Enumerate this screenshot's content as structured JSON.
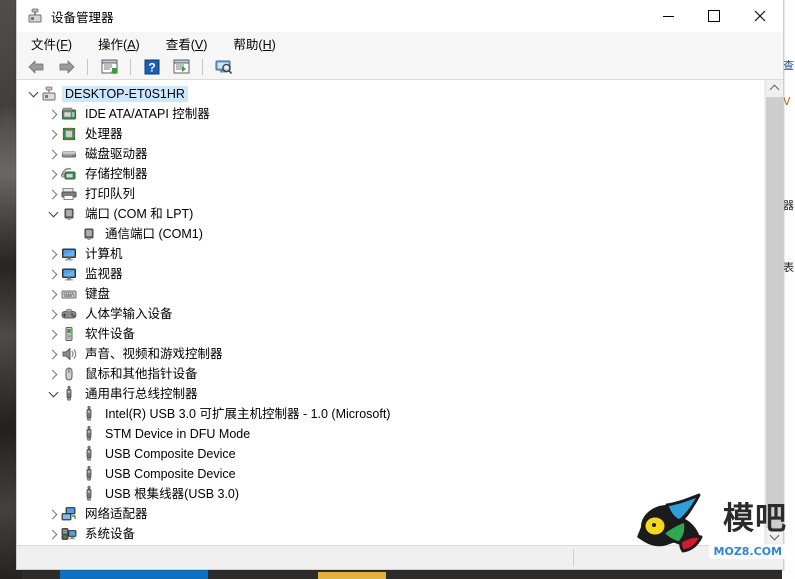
{
  "window": {
    "title": "设备管理器",
    "icon": "device-manager-icon",
    "controls": {
      "minimize": "–",
      "maximize": "□",
      "close": "✕"
    }
  },
  "menubar": {
    "items": [
      {
        "name": "file",
        "text": "文件",
        "accel": "F"
      },
      {
        "name": "action",
        "text": "操作",
        "accel": "A"
      },
      {
        "name": "view",
        "text": "查看",
        "accel": "V"
      },
      {
        "name": "help",
        "text": "帮助",
        "accel": "H"
      }
    ]
  },
  "toolbar": {
    "buttons": [
      {
        "name": "back-button",
        "icon": "back-arrow-icon"
      },
      {
        "name": "forward-button",
        "icon": "forward-arrow-icon"
      },
      {
        "name": "properties-button",
        "icon": "properties-icon"
      },
      {
        "name": "help-button",
        "icon": "help-question-icon"
      },
      {
        "name": "update-driver-button",
        "icon": "update-driver-icon"
      },
      {
        "name": "scan-hardware-button",
        "icon": "scan-hardware-icon"
      }
    ]
  },
  "tree": {
    "nodes": [
      {
        "label": "DESKTOP-ET0S1HR",
        "depth": 0,
        "state": "expanded",
        "icon": "computer-node-icon",
        "selected": true
      },
      {
        "label": "IDE ATA/ATAPI 控制器",
        "depth": 1,
        "state": "collapsed",
        "icon": "ide-controller-icon",
        "selected": false
      },
      {
        "label": "处理器",
        "depth": 1,
        "state": "collapsed",
        "icon": "processor-icon",
        "selected": false
      },
      {
        "label": "磁盘驱动器",
        "depth": 1,
        "state": "collapsed",
        "icon": "disk-drive-icon",
        "selected": false
      },
      {
        "label": "存储控制器",
        "depth": 1,
        "state": "collapsed",
        "icon": "storage-controller-icon",
        "selected": false
      },
      {
        "label": "打印队列",
        "depth": 1,
        "state": "collapsed",
        "icon": "print-queue-icon",
        "selected": false
      },
      {
        "label": "端口 (COM 和 LPT)",
        "depth": 1,
        "state": "expanded",
        "icon": "port-icon",
        "selected": false
      },
      {
        "label": "通信端口 (COM1)",
        "depth": 2,
        "state": "leaf",
        "icon": "port-icon",
        "selected": false
      },
      {
        "label": "计算机",
        "depth": 1,
        "state": "collapsed",
        "icon": "monitor-icon",
        "selected": false
      },
      {
        "label": "监视器",
        "depth": 1,
        "state": "collapsed",
        "icon": "monitor-icon",
        "selected": false
      },
      {
        "label": "键盘",
        "depth": 1,
        "state": "collapsed",
        "icon": "keyboard-icon",
        "selected": false
      },
      {
        "label": "人体学输入设备",
        "depth": 1,
        "state": "collapsed",
        "icon": "hid-gamepad-icon",
        "selected": false
      },
      {
        "label": "软件设备",
        "depth": 1,
        "state": "collapsed",
        "icon": "software-device-icon",
        "selected": false
      },
      {
        "label": "声音、视频和游戏控制器",
        "depth": 1,
        "state": "collapsed",
        "icon": "sound-speaker-icon",
        "selected": false
      },
      {
        "label": "鼠标和其他指针设备",
        "depth": 1,
        "state": "collapsed",
        "icon": "mouse-icon",
        "selected": false
      },
      {
        "label": "通用串行总线控制器",
        "depth": 1,
        "state": "expanded",
        "icon": "usb-icon",
        "selected": false
      },
      {
        "label": "Intel(R) USB 3.0 可扩展主机控制器 - 1.0 (Microsoft)",
        "depth": 2,
        "state": "leaf",
        "icon": "usb-icon",
        "selected": false
      },
      {
        "label": "STM Device in DFU Mode",
        "depth": 2,
        "state": "leaf",
        "icon": "usb-icon",
        "selected": false
      },
      {
        "label": "USB Composite Device",
        "depth": 2,
        "state": "leaf",
        "icon": "usb-icon",
        "selected": false
      },
      {
        "label": "USB Composite Device",
        "depth": 2,
        "state": "leaf",
        "icon": "usb-icon",
        "selected": false
      },
      {
        "label": "USB 根集线器(USB 3.0)",
        "depth": 2,
        "state": "leaf",
        "icon": "usb-icon",
        "selected": false
      },
      {
        "label": "网络适配器",
        "depth": 1,
        "state": "collapsed",
        "icon": "network-adapter-icon",
        "selected": false
      },
      {
        "label": "系统设备",
        "depth": 1,
        "state": "collapsed",
        "icon": "system-device-icon",
        "selected": false
      }
    ]
  },
  "scrollbar": {
    "up": "scroll-up-icon",
    "down": "scroll-down-icon"
  },
  "statusbar": {
    "text": ""
  },
  "watermark": {
    "brand": "模吧",
    "url": "MOZ8.COM",
    "logo": "bird-logo-icon"
  },
  "colors": {
    "selection": "#cce8ff",
    "window_bg": "#f0f0f0",
    "tree_bg": "#ffffff",
    "accent_blue": "#2f86d8"
  }
}
